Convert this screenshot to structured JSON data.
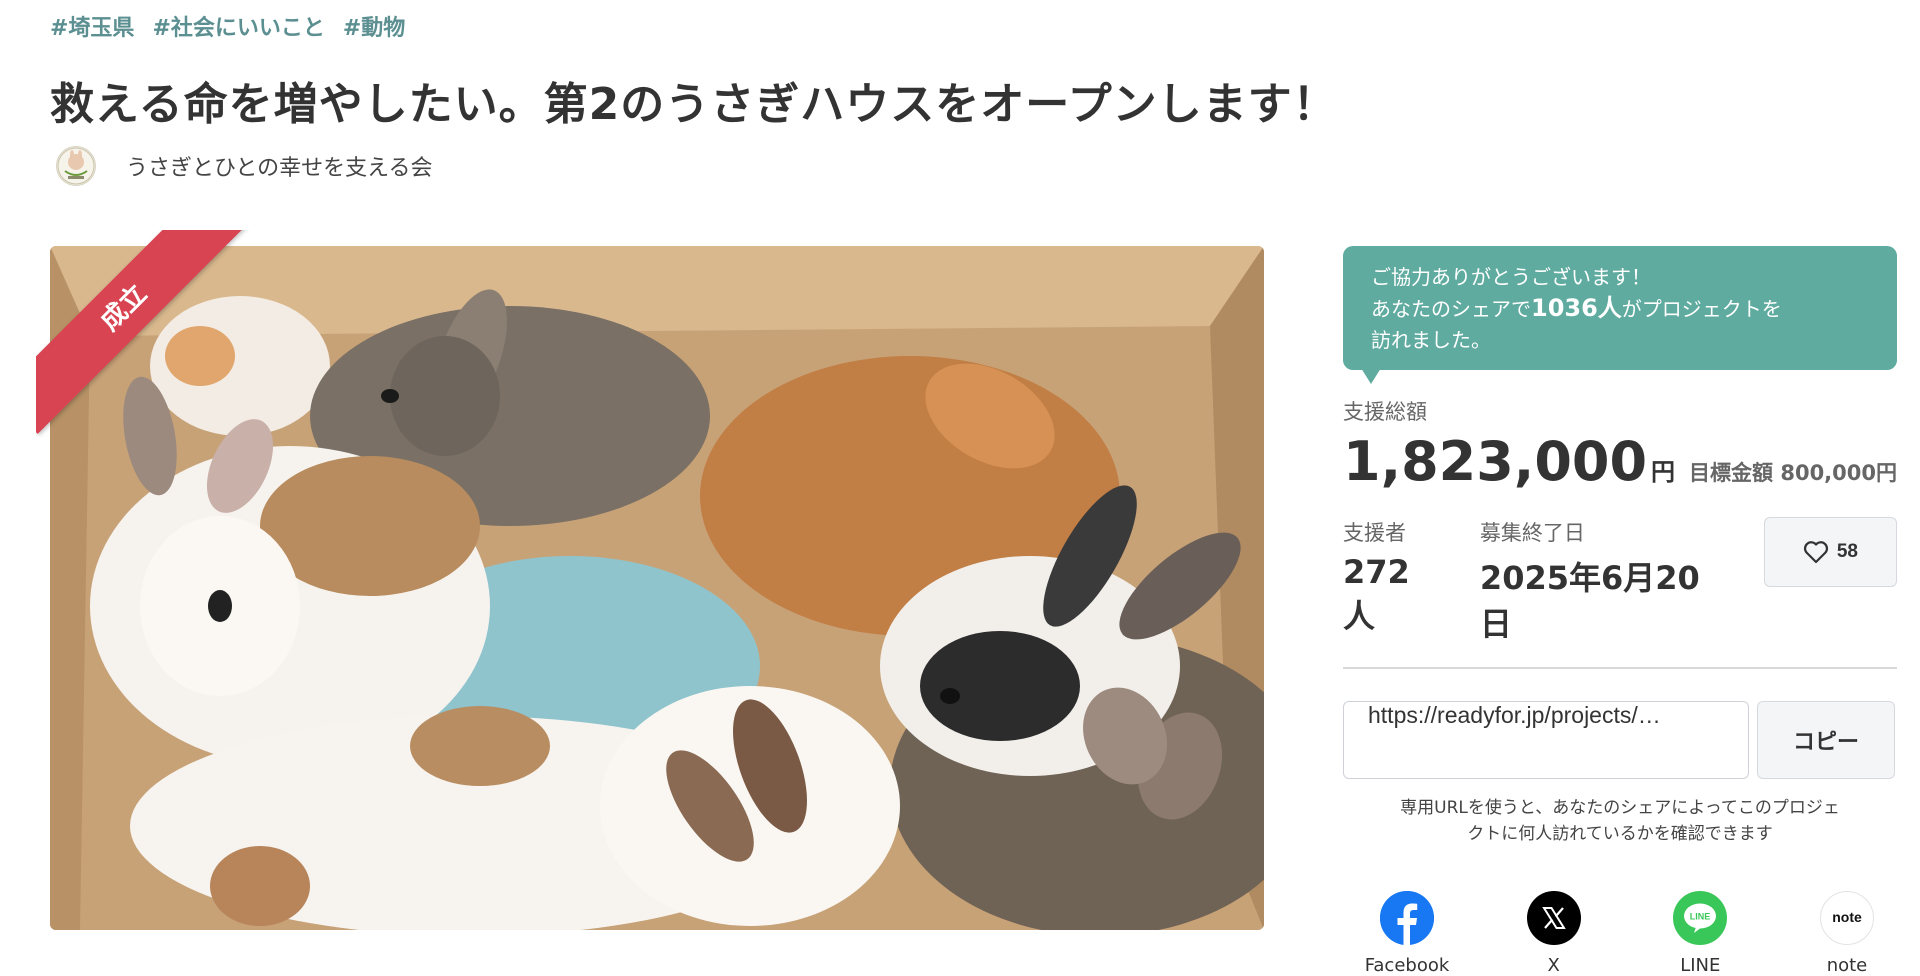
{
  "tags": [
    "#埼玉県",
    "#社会にいいこと",
    "#動物"
  ],
  "project": {
    "title": "救える命を増やしたい。第2のうさぎハウスをオープンします！",
    "owner_name": "うさぎとひとの幸せを支える会",
    "status_ribbon": "成立"
  },
  "share": {
    "line1": "ご協力ありがとうございます！",
    "line2_prefix": "あなたのシェアで",
    "visitor_count": "1036人",
    "line2_suffix": "がプロジェクトを",
    "line3": "訪れました。"
  },
  "funding": {
    "total_label": "支援総額",
    "total_amount": "1,823,000",
    "currency": "円",
    "goal_text": "目標金額 800,000円",
    "supporters_label": "支援者",
    "supporters_value": "272人",
    "end_date_label": "募集終了日",
    "end_date_value": "2025年6月20日",
    "favorite_count": "58"
  },
  "url_share": {
    "url_value": "https://readyfor.jp/projects/…",
    "copy_label": "コピー",
    "note_line1": "専用URLを使うと、あなたのシェアによってこのプロジェ",
    "note_line2": "クトに何人訪れているかを確認できます"
  },
  "social": [
    {
      "label": "Facebook",
      "icon": "facebook-icon",
      "color": "#1877f2"
    },
    {
      "label": "X",
      "icon": "x-icon",
      "color": "#000000"
    },
    {
      "label": "LINE",
      "icon": "line-icon",
      "color": "#3ac759"
    },
    {
      "label": "note",
      "icon": "note-icon",
      "color": "#ffffff"
    }
  ],
  "colors": {
    "accent_teal": "#5fab9f",
    "tag_color": "#5c8f91",
    "ribbon_red": "#d94452"
  }
}
